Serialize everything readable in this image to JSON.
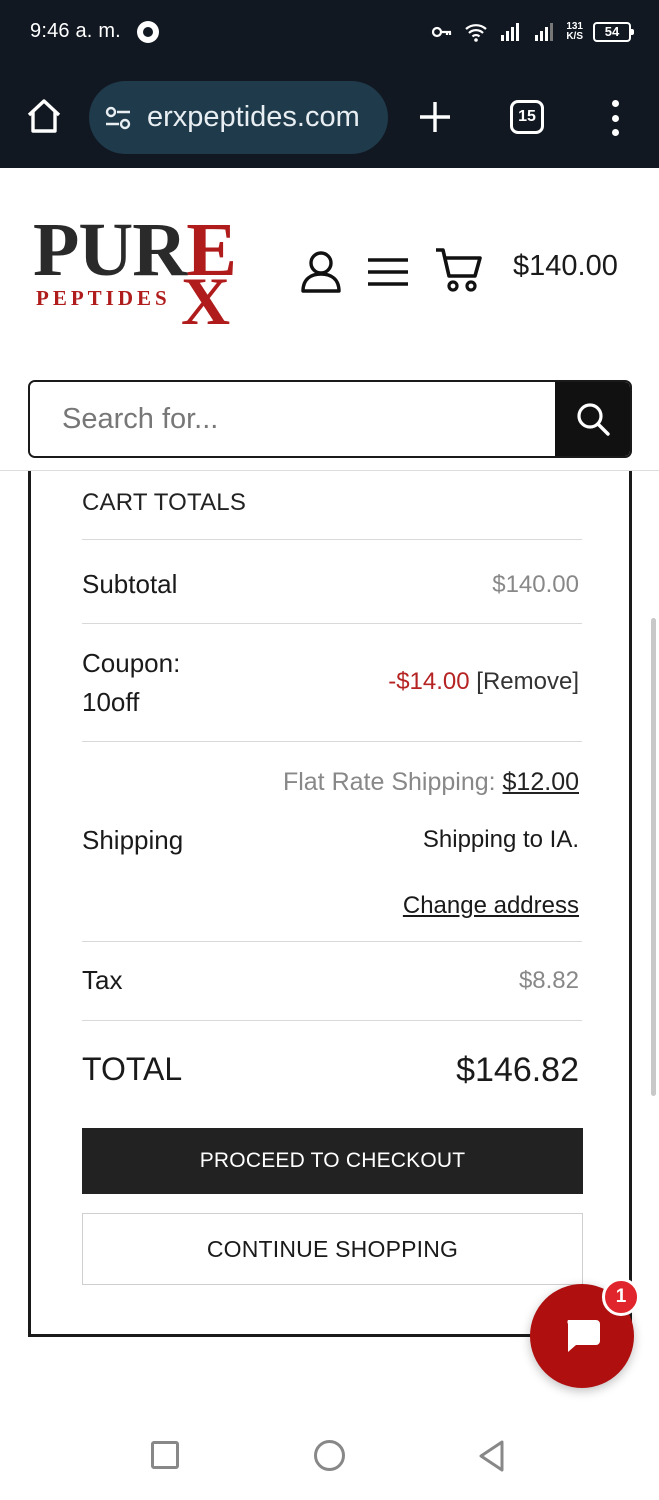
{
  "status_bar": {
    "time": "9:46 a. m.",
    "net_speed_top": "131",
    "net_speed_bottom": "K/S",
    "battery": "54"
  },
  "browser": {
    "url": "erxpeptides.com",
    "tab_count": "15"
  },
  "site": {
    "logo_main": "PURE",
    "logo_sub": "PEPTIDES",
    "logo_x": "X",
    "cart_total": "$140.00"
  },
  "search": {
    "placeholder": "Search for..."
  },
  "cart_totals": {
    "title": "CART TOTALS",
    "subtotal_label": "Subtotal",
    "subtotal_value": "$140.00",
    "coupon_label_line1": "Coupon:",
    "coupon_label_line2": "10off",
    "coupon_value": "-$14.00",
    "coupon_remove": "[Remove]",
    "shipping_label": "Shipping",
    "shipping_method": "Flat Rate Shipping:",
    "shipping_amount": "$12.00",
    "shipping_to": "Shipping to IA.",
    "change_address": "Change address",
    "tax_label": "Tax",
    "tax_value": "$8.82",
    "total_label": "TOTAL",
    "total_value": "$146.82",
    "checkout_button": "PROCEED TO CHECKOUT",
    "continue_button": "CONTINUE SHOPPING"
  },
  "chat": {
    "badge_count": "1"
  },
  "colors": {
    "brand_red": "#b01c1c",
    "chrome_bg": "#111822",
    "url_pill": "#1f3a4a",
    "button_dark": "#222222",
    "chat_red": "#b00f0f"
  },
  "icons": [
    "home-icon",
    "site-settings-icon",
    "plus-icon",
    "tabs-icon",
    "more-icon",
    "user-icon",
    "hamburger-icon",
    "cart-icon",
    "search-icon",
    "chat-icon"
  ]
}
